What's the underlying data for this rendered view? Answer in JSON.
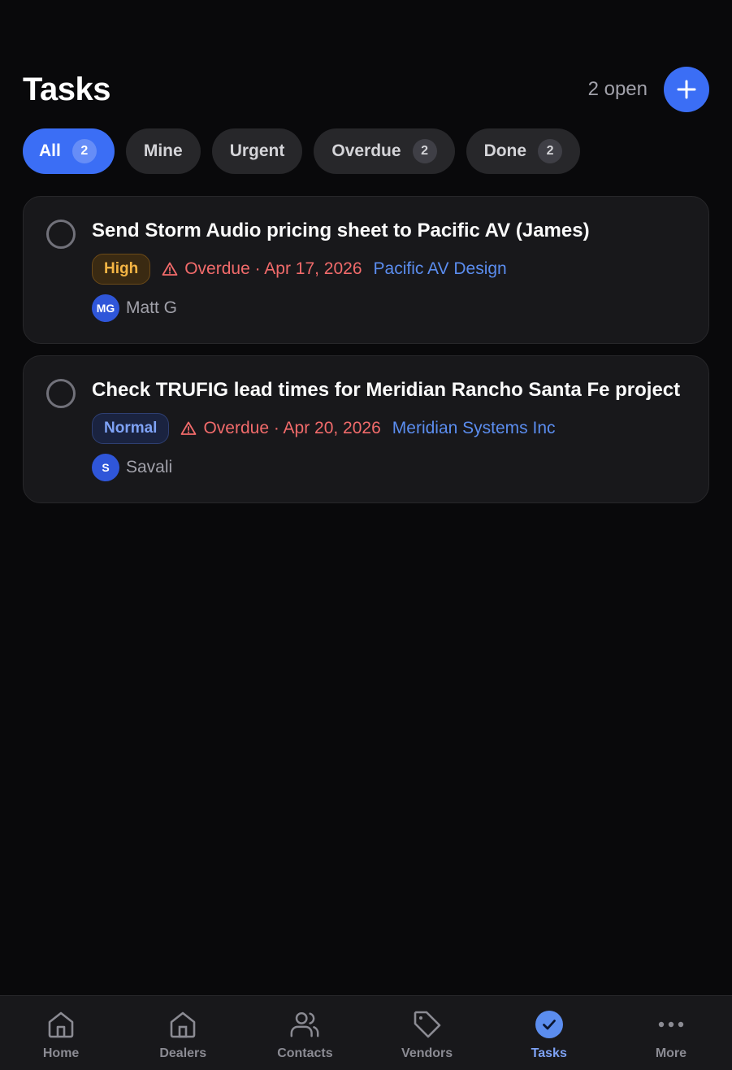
{
  "header": {
    "title": "Tasks",
    "open_count": "2 open",
    "add_icon": "plus-icon"
  },
  "filters": [
    {
      "label": "All",
      "count": "2",
      "active": true
    },
    {
      "label": "Mine",
      "count": null,
      "active": false
    },
    {
      "label": "Urgent",
      "count": null,
      "active": false
    },
    {
      "label": "Overdue",
      "count": "2",
      "active": false
    },
    {
      "label": "Done",
      "count": "2",
      "active": false
    }
  ],
  "tasks": [
    {
      "title": "Send Storm Audio pricing sheet to Pacific AV (James)",
      "priority": "High",
      "priority_level": "high",
      "status_icon": "warning-triangle-icon",
      "overdue_text": "Overdue · Apr 17, 2026",
      "dealer": "Pacific AV Design",
      "assignee_initials": "MG",
      "assignee_name": "Matt G"
    },
    {
      "title": "Check TRUFIG lead times for Meridian Rancho Santa Fe project",
      "priority": "Normal",
      "priority_level": "normal",
      "status_icon": "warning-triangle-icon",
      "overdue_text": "Overdue · Apr 20, 2026",
      "dealer": "Meridian Systems Inc",
      "assignee_initials": "S",
      "assignee_name": "Savali"
    }
  ],
  "nav": {
    "items": [
      {
        "label": "Home",
        "icon": "home-icon",
        "active": false
      },
      {
        "label": "Dealers",
        "icon": "building-icon",
        "active": false
      },
      {
        "label": "Contacts",
        "icon": "users-icon",
        "active": false
      },
      {
        "label": "Vendors",
        "icon": "tag-icon",
        "active": false
      },
      {
        "label": "Tasks",
        "icon": "check-circle-icon",
        "active": true
      },
      {
        "label": "More",
        "icon": "more-dots-icon",
        "active": false
      }
    ]
  },
  "colors": {
    "accent": "#3b6ef5",
    "overdue": "#f26b6b",
    "link": "#5b8def",
    "high_priority": "#f5b544",
    "normal_priority": "#7ea2f5",
    "background": "#09090b"
  }
}
